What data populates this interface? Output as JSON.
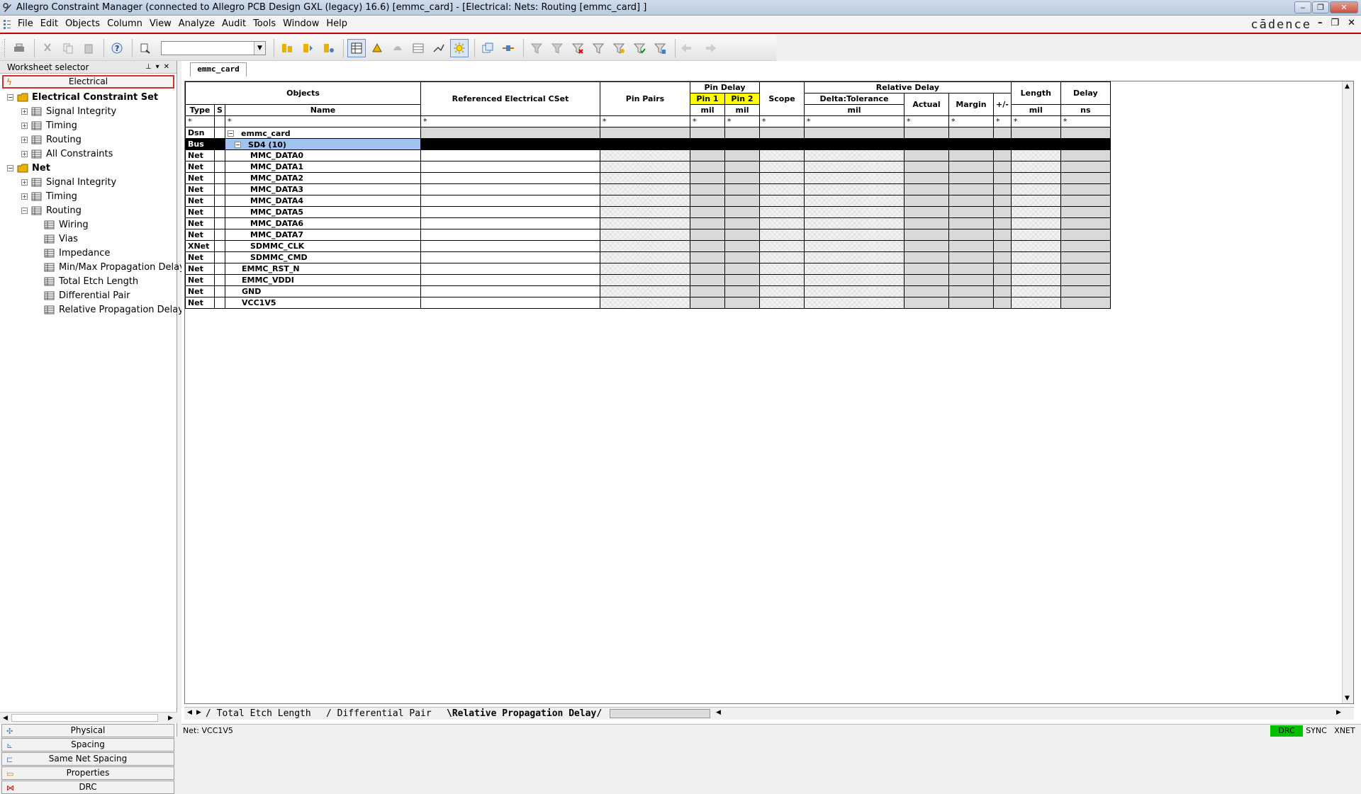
{
  "window": {
    "title": "Allegro Constraint Manager (connected to Allegro PCB Design GXL (legacy) 16.6) [emmc_card] - [Electrical:  Nets: Routing [emmc_card] ]",
    "brand": "cādence"
  },
  "menu": [
    "File",
    "Edit",
    "Objects",
    "Column",
    "View",
    "Analyze",
    "Audit",
    "Tools",
    "Window",
    "Help"
  ],
  "left_panel": {
    "title": "Worksheet selector",
    "active_domain": "Electrical",
    "tree": [
      {
        "label": "Electrical Constraint Set",
        "level": 0,
        "bold": true,
        "expander": "−"
      },
      {
        "label": "Signal Integrity",
        "level": 1,
        "expander": "+"
      },
      {
        "label": "Timing",
        "level": 1,
        "expander": "+"
      },
      {
        "label": "Routing",
        "level": 1,
        "expander": "+"
      },
      {
        "label": "All Constraints",
        "level": 1,
        "expander": "+"
      },
      {
        "label": "Net",
        "level": 0,
        "bold": true,
        "expander": "−"
      },
      {
        "label": "Signal Integrity",
        "level": 1,
        "expander": "+"
      },
      {
        "label": "Timing",
        "level": 1,
        "expander": "+"
      },
      {
        "label": "Routing",
        "level": 1,
        "expander": "−"
      },
      {
        "label": "Wiring",
        "level": 2
      },
      {
        "label": "Vias",
        "level": 2
      },
      {
        "label": "Impedance",
        "level": 2
      },
      {
        "label": "Min/Max Propagation Delay",
        "level": 2
      },
      {
        "label": "Total Etch Length",
        "level": 2
      },
      {
        "label": "Differential Pair",
        "level": 2
      },
      {
        "label": "Relative Propagation Delay",
        "level": 2
      }
    ],
    "domains": [
      "Physical",
      "Spacing",
      "Same Net Spacing",
      "Properties",
      "DRC"
    ]
  },
  "document_tab": "emmc_card",
  "grid": {
    "headers": {
      "objects": "Objects",
      "type": "Type",
      "s": "S",
      "name": "Name",
      "ref_cset": "Referenced Electrical CSet",
      "pin_pairs": "Pin Pairs",
      "pin_delay": "Pin Delay",
      "pin1": "Pin 1",
      "pin2": "Pin 2",
      "unit_mil": "mil",
      "scope": "Scope",
      "relative_delay": "Relative Delay",
      "delta_tol": "Delta:Tolerance",
      "actual": "Actual",
      "margin": "Margin",
      "plusminus": "+/-",
      "length": "Length",
      "delay": "Delay",
      "unit_ns": "ns",
      "filter": "*"
    },
    "rows": [
      {
        "type": "Dsn",
        "name": "emmc_card",
        "indent": 1,
        "expander": "−"
      },
      {
        "type": "Bus",
        "name": "SD4 (10)",
        "indent": 2,
        "expander": "−",
        "selected": true
      },
      {
        "type": "Net",
        "name": "MMC_DATA0",
        "indent": 3
      },
      {
        "type": "Net",
        "name": "MMC_DATA1",
        "indent": 3
      },
      {
        "type": "Net",
        "name": "MMC_DATA2",
        "indent": 3
      },
      {
        "type": "Net",
        "name": "MMC_DATA3",
        "indent": 3
      },
      {
        "type": "Net",
        "name": "MMC_DATA4",
        "indent": 3
      },
      {
        "type": "Net",
        "name": "MMC_DATA5",
        "indent": 3
      },
      {
        "type": "Net",
        "name": "MMC_DATA6",
        "indent": 3
      },
      {
        "type": "Net",
        "name": "MMC_DATA7",
        "indent": 3
      },
      {
        "type": "XNet",
        "name": "SDMMC_CLK",
        "indent": 3
      },
      {
        "type": "Net",
        "name": "SDMMC_CMD",
        "indent": 3
      },
      {
        "type": "Net",
        "name": "EMMC_RST_N",
        "indent": 2
      },
      {
        "type": "Net",
        "name": "EMMC_VDDI",
        "indent": 2
      },
      {
        "type": "Net",
        "name": "GND",
        "indent": 2
      },
      {
        "type": "Net",
        "name": "VCC1V5",
        "indent": 2
      }
    ]
  },
  "sheet_tabs": [
    "Total Etch Length",
    "Differential Pair",
    "Relative Propagation Delay"
  ],
  "status": {
    "text": "Net: VCC1V5",
    "drc": "DRC",
    "sync": "SYNC",
    "xnet": "XNET"
  },
  "colors": {
    "accent_red": "#c00000",
    "highlight_yellow": "#ffff00",
    "selection_blue": "#9fc2ee",
    "drc_green": "#00c000"
  }
}
